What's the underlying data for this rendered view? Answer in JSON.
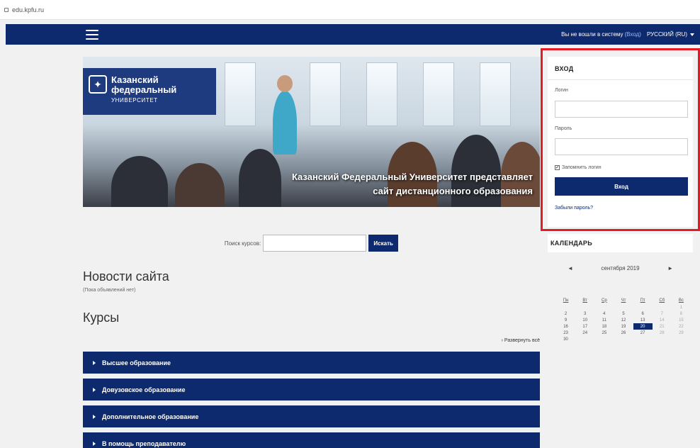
{
  "url": "edu.kpfu.ru",
  "navbar": {
    "login_status": "Вы не вошли в систему",
    "login_link": "(Вход)",
    "language": "РУССКИЙ (RU)"
  },
  "banner": {
    "logo_line1": "Казанский",
    "logo_line2": "федеральный",
    "logo_line3": "УНИВЕРСИТЕТ",
    "caption_line1": "Казанский Федеральный Университет представляет",
    "caption_line2": "сайт дистанционного образования"
  },
  "search": {
    "label": "Поиск курсов:",
    "value": "",
    "button": "Искать"
  },
  "news": {
    "title": "Новости сайта",
    "empty": "(Пока объявлений нет)"
  },
  "courses": {
    "title": "Курсы",
    "expand_all": "Развернуть всё",
    "categories": [
      "Высшее образование",
      "Довузовское образование",
      "Дополнительное образование",
      "В помощь преподавателю"
    ]
  },
  "login": {
    "title": "ВХОД",
    "username_label": "Логин",
    "password_label": "Пароль",
    "remember": "Запомнить логин",
    "button": "Вход",
    "forgot": "Забыли пароль?"
  },
  "calendar": {
    "title": "КАЛЕНДАРЬ",
    "prev": "◄",
    "next": "►",
    "month": "сентября 2019",
    "weekdays": [
      "Пн",
      "Вт",
      "Ср",
      "Чт",
      "Пт",
      "Сб",
      "Вс"
    ],
    "weeks": [
      [
        "",
        "",
        "",
        "",
        "",
        "",
        "1"
      ],
      [
        "2",
        "3",
        "4",
        "5",
        "6",
        "7",
        "8"
      ],
      [
        "9",
        "10",
        "11",
        "12",
        "13",
        "14",
        "15"
      ],
      [
        "16",
        "17",
        "18",
        "19",
        "20",
        "21",
        "22"
      ],
      [
        "23",
        "24",
        "25",
        "26",
        "27",
        "28",
        "29"
      ],
      [
        "30",
        "",
        "",
        "",
        "",
        "",
        ""
      ]
    ],
    "today": "20"
  }
}
